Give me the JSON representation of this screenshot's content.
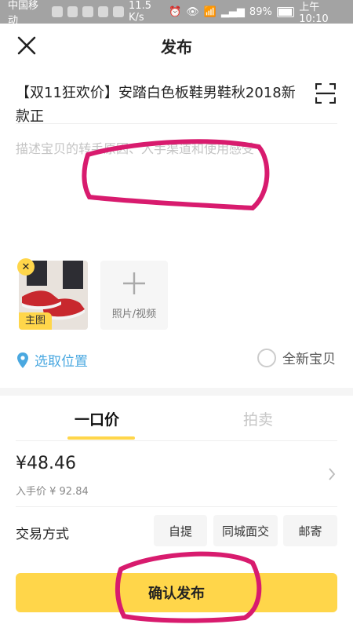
{
  "status_bar": {
    "carrier": "中国移动",
    "speed": "11.5 K/s",
    "battery": "89%",
    "time": "上午10:10"
  },
  "header": {
    "title": "发布"
  },
  "listing": {
    "title": "【双11狂欢价】安踏白色板鞋男鞋秋2018新款正",
    "description_placeholder": "描述宝贝的转手原因、入手渠道和使用感受"
  },
  "media": {
    "main_badge": "主图",
    "add_label": "照片/视频"
  },
  "location": {
    "label": "选取位置"
  },
  "condition": {
    "label": "全新宝贝"
  },
  "pricing_tabs": [
    {
      "label": "一口价",
      "active": true
    },
    {
      "label": "拍卖",
      "active": false
    }
  ],
  "price": {
    "value": "¥48.46",
    "purchase_price": "入手价 ¥ 92.84"
  },
  "trade": {
    "label": "交易方式",
    "options": [
      "自提",
      "同城面交",
      "邮寄"
    ]
  },
  "confirm_button": "确认发布",
  "colors": {
    "accent": "#ffd64a",
    "location_blue": "#4aa8e0",
    "annotation_pink": "#d81b6e"
  }
}
